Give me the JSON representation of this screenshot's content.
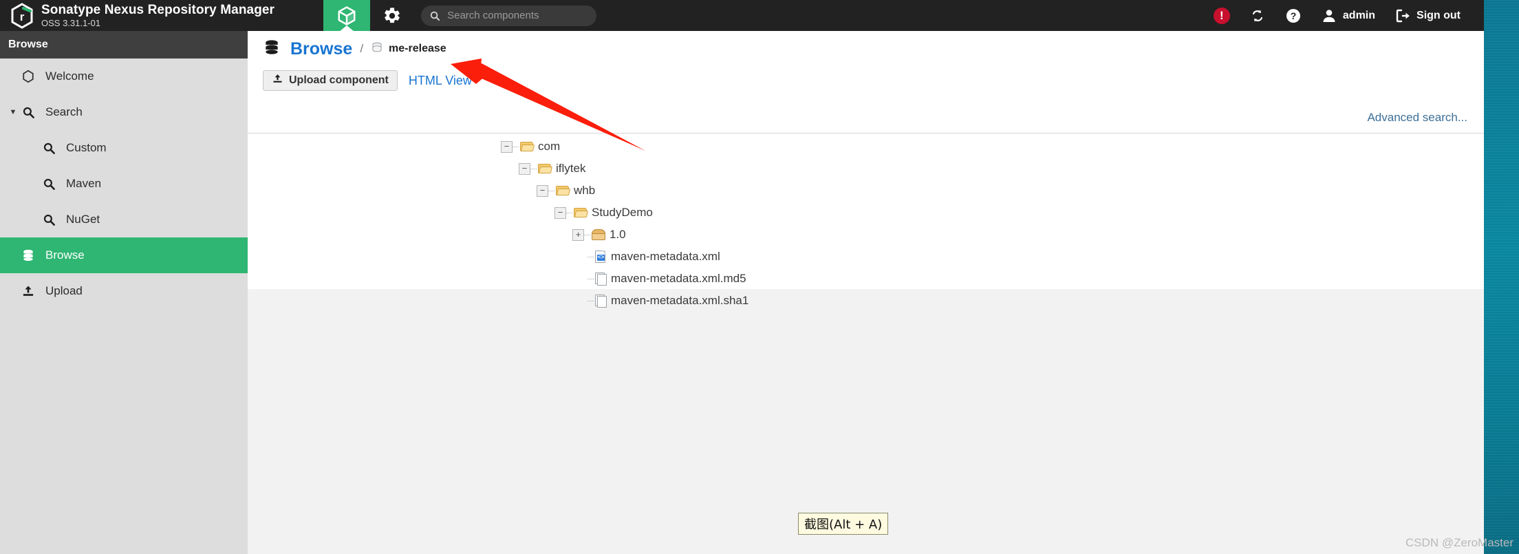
{
  "header": {
    "logo_icon": "nexus-hexagon-logo",
    "brand_title": "Sonatype Nexus Repository Manager",
    "brand_subtitle": "OSS 3.31.1-01",
    "browse_tab_icon": "cube-icon",
    "settings_tab_icon": "gear-icon",
    "search": {
      "icon": "search-icon",
      "placeholder": "Search components",
      "value": ""
    },
    "right": {
      "alert_icon": "alert-exclamation-icon",
      "alert_badge": "!",
      "refresh_icon": "refresh-icon",
      "help_icon": "help-question-icon",
      "user_icon": "user-avatar-icon",
      "user_label": "admin",
      "signout_icon": "sign-out-icon",
      "signout_label": "Sign out"
    }
  },
  "sidebar": {
    "header": "Browse",
    "items": [
      {
        "label": "Welcome",
        "icon": "hexagon-icon",
        "level": 0,
        "active": false,
        "caret": ""
      },
      {
        "label": "Search",
        "icon": "search-icon",
        "level": 0,
        "active": false,
        "caret": "▼"
      },
      {
        "label": "Custom",
        "icon": "search-icon",
        "level": 1,
        "active": false,
        "caret": ""
      },
      {
        "label": "Maven",
        "icon": "search-icon",
        "level": 1,
        "active": false,
        "caret": ""
      },
      {
        "label": "NuGet",
        "icon": "search-icon",
        "level": 1,
        "active": false,
        "caret": ""
      },
      {
        "label": "Browse",
        "icon": "database-icon",
        "level": 0,
        "active": true,
        "caret": ""
      },
      {
        "label": "Upload",
        "icon": "upload-icon",
        "level": 0,
        "active": false,
        "caret": ""
      }
    ]
  },
  "main": {
    "breadcrumb": {
      "root_icon": "database-icon",
      "root_label": "Browse",
      "separator": "/",
      "leaf_icon": "repository-icon",
      "leaf_label": "me-release"
    },
    "toolbar": {
      "upload_icon": "upload-icon",
      "upload_label": "Upload component",
      "html_view_label": "HTML View",
      "advanced_search_label": "Advanced search..."
    },
    "tree": [
      {
        "label": "com",
        "icon": "folder-icon",
        "depth": 0,
        "toggle": "−"
      },
      {
        "label": "iflytek",
        "icon": "folder-icon",
        "depth": 1,
        "toggle": "−"
      },
      {
        "label": "whb",
        "icon": "folder-icon",
        "depth": 2,
        "toggle": "−"
      },
      {
        "label": "StudyDemo",
        "icon": "folder-icon",
        "depth": 3,
        "toggle": "−"
      },
      {
        "label": "1.0",
        "icon": "package-icon",
        "depth": 4,
        "toggle": "+"
      },
      {
        "label": "maven-metadata.xml",
        "icon": "xml-file-icon",
        "depth": 5,
        "toggle": ""
      },
      {
        "label": "maven-metadata.xml.md5",
        "icon": "file-icon",
        "depth": 5,
        "toggle": ""
      },
      {
        "label": "maven-metadata.xml.sha1",
        "icon": "file-icon",
        "depth": 5,
        "toggle": ""
      }
    ]
  },
  "overlay": {
    "annotation_arrow": "red-arrow-pointing-to-me-release",
    "tooltip_label": "截图(Alt + A)",
    "watermark": "CSDN @ZeroMaster"
  },
  "colors": {
    "header_bg": "#222222",
    "accent_green": "#2eb672",
    "link_blue": "#1975d1",
    "sidebar_bg": "#dddddd",
    "alert_red": "#c8102e",
    "annotation_red": "#fb1e0b",
    "desktop_teal": "#0a7d96"
  }
}
